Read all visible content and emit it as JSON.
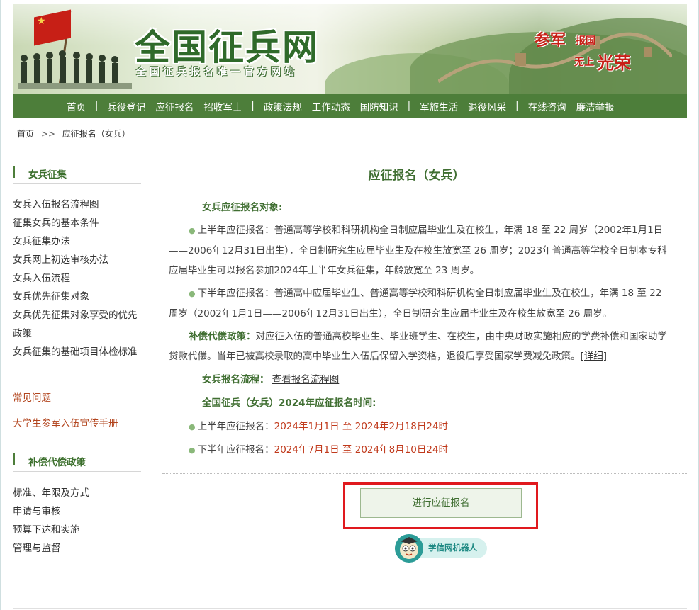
{
  "banner": {
    "title": "全国征兵网",
    "subtitle": "全国征兵报名唯一官方网站",
    "slogan": {
      "a": "参军",
      "b": "报国",
      "c": "无上",
      "d": "光荣"
    }
  },
  "nav": {
    "items": [
      "首页",
      "|",
      "兵役登记",
      "应征报名",
      "招收军士",
      "|",
      "政策法规",
      "工作动态",
      "国防知识",
      "|",
      "军旅生活",
      "退役风采",
      "|",
      "在线咨询",
      "廉洁举报"
    ]
  },
  "breadcrumb": {
    "home": "首页",
    "sep": ">>",
    "current": "应征报名（女兵）"
  },
  "sidebar": {
    "section1": {
      "title": "女兵征集",
      "links": [
        "女兵入伍报名流程图",
        "征集女兵的基本条件",
        "女兵征集办法",
        "女兵网上初选审核办法",
        "女兵入伍流程",
        "女兵优先征集对象",
        "女兵优先征集对象享受的优先政策",
        "女兵征集的基础项目体检标准"
      ]
    },
    "faq": "常见问题",
    "handbook": "大学生参军入伍宣传手册",
    "section2": {
      "title": "补偿代偿政策",
      "links": [
        "标准、年限及方式",
        "申请与审核",
        "预算下达和实施",
        "管理与监督"
      ]
    }
  },
  "main": {
    "title": "应征报名（女兵）",
    "target_label": "女兵应征报名对象:",
    "first_half": "上半年应征报名：普通高等学校和科研机构全日制应届毕业生及在校生，年满 18 至 22 周岁（2002年1月1日——2006年12月31日出生），全日制研究生应届毕业生及在校生放宽至 26 周岁；2023年普通高等学校全日制本专科应届毕业生可以报名参加2024年上半年女兵征集，年龄放宽至 23 周岁。",
    "second_half": "下半年应征报名：普通高中应届毕业生、普通高等学校和科研机构全日制应届毕业生及在校生，年满 18 至 22 周岁（2002年1月1日——2006年12月31日出生），全日制研究生应届毕业生及在校生放宽至 26 周岁。",
    "comp_label": "补偿代偿政策：",
    "comp_text": "对应征入伍的普通高校毕业生、毕业班学生、在校生，由中央财政实施相应的学费补偿和国家助学贷款代偿。当年已被高校录取的高中毕业生入伍后保留入学资格，退役后享受国家学费减免政策。",
    "detail_link": "[详细]",
    "flow_label": "女兵报名流程：",
    "flow_link": "查看报名流程图",
    "time_label": "全国征兵（女兵）2024年应征报名时间:",
    "time1_label": "上半年应征报名：",
    "time1_value": "2024年1月1日 至 2024年2月18日24时",
    "time2_label": "下半年应征报名：",
    "time2_value": "2024年7月1日 至 2024年8月10日24时",
    "button": "进行应征报名",
    "robot": "学信网机器人"
  }
}
